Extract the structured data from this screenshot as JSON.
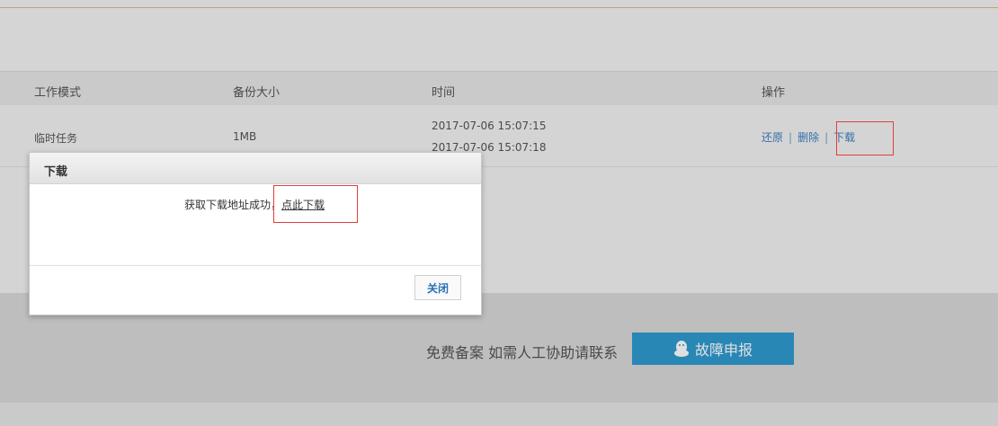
{
  "table": {
    "headers": [
      "工作模式",
      "备份大小",
      "时间",
      "操作"
    ],
    "row": {
      "mode": "临时任务",
      "size": "1MB",
      "time_start": "2017-07-06 15:07:15",
      "time_end": "2017-07-06 15:07:18",
      "actions": [
        "还原",
        "删除",
        "下载"
      ],
      "separator": "|"
    }
  },
  "footer": {
    "text": "免费备案 如需人工协助请联系",
    "report_button": "故障申报",
    "report_icon": "qq-penguin-icon"
  },
  "dialog": {
    "title": "下载",
    "message": "获取下载地址成功，",
    "download_link": "点此下载",
    "close_button": "关闭"
  },
  "colors": {
    "link": "#3d7fc1",
    "highlight_box": "#e23d3d",
    "report_button_bg": "#2f9ad0"
  }
}
